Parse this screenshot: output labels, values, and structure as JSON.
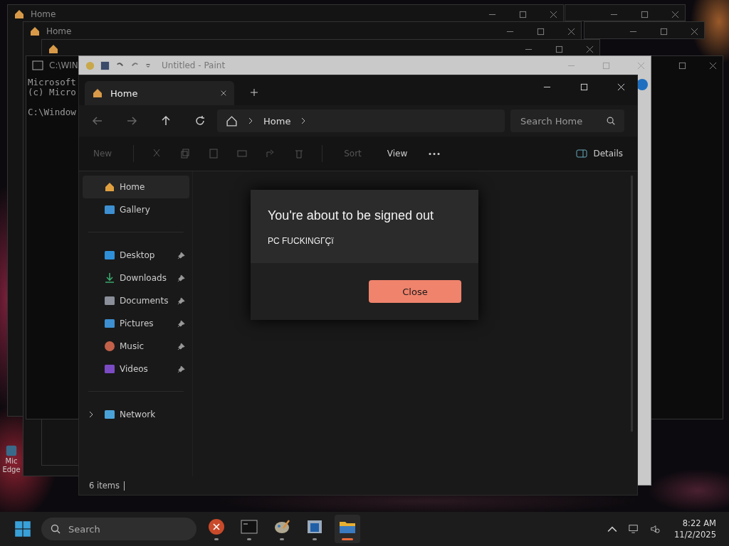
{
  "background_windows": [
    {
      "kind": "explorer",
      "tab": "Home"
    },
    {
      "kind": "explorer",
      "tab": "Home"
    },
    {
      "kind": "explorer"
    }
  ],
  "console": {
    "title": "C:\\WIN",
    "lines": [
      "Microsoft",
      "(c) Micro"
    ],
    "prompt": "C:\\Window"
  },
  "paint": {
    "title": "Untitled - Paint"
  },
  "desktop_icon": {
    "lines": [
      "Mic",
      "Edge"
    ]
  },
  "explorer": {
    "tab": {
      "label": "Home",
      "selected": true
    },
    "breadcrumb": [
      "Home"
    ],
    "search": {
      "placeholder": "Search Home"
    },
    "toolbar": {
      "new": "New",
      "sort": "Sort",
      "view": "View",
      "details": "Details"
    },
    "sidebar": [
      {
        "label": "Home",
        "kind": "home",
        "selected": true,
        "pinned": false
      },
      {
        "label": "Gallery",
        "kind": "gallery",
        "selected": false,
        "pinned": false
      },
      {
        "label": "Desktop",
        "kind": "desktop",
        "selected": false,
        "pinned": true
      },
      {
        "label": "Downloads",
        "kind": "downloads",
        "selected": false,
        "pinned": true
      },
      {
        "label": "Documents",
        "kind": "documents",
        "selected": false,
        "pinned": true
      },
      {
        "label": "Pictures",
        "kind": "pictures",
        "selected": false,
        "pinned": true
      },
      {
        "label": "Music",
        "kind": "music",
        "selected": false,
        "pinned": true
      },
      {
        "label": "Videos",
        "kind": "videos",
        "selected": false,
        "pinned": true
      },
      {
        "label": "Network",
        "kind": "network",
        "selected": false,
        "pinned": false,
        "expanded": false
      }
    ],
    "status": "6 items"
  },
  "dialog": {
    "title": "You're about to be signed out",
    "message": "PC FUCKINGΓÇï",
    "button": "Close"
  },
  "taskbar": {
    "search": {
      "placeholder": "Search"
    },
    "apps": [
      {
        "kind": "error",
        "selected": false
      },
      {
        "kind": "terminal",
        "selected": false
      },
      {
        "kind": "paint",
        "selected": false
      },
      {
        "kind": "window",
        "selected": false
      },
      {
        "kind": "folder",
        "selected": true
      }
    ],
    "time": "8:22 AM",
    "date": "11/2/2025"
  }
}
